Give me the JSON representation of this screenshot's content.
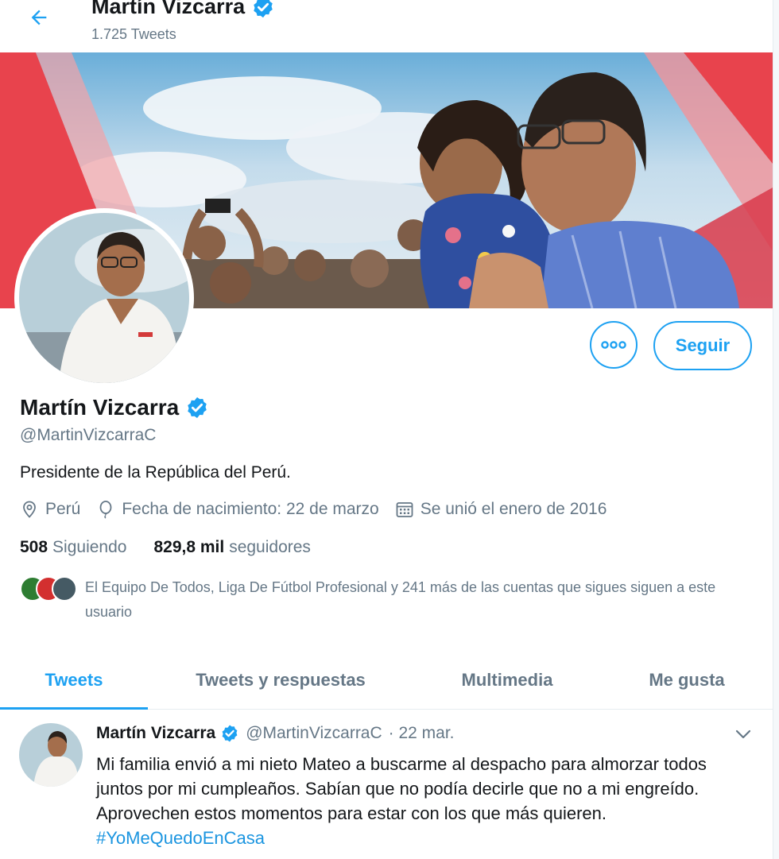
{
  "header": {
    "title": "Martín Vizcarra",
    "tweet_count": "1.725 Tweets"
  },
  "profile": {
    "name": "Martín Vizcarra",
    "handle": "@MartinVizcarraC",
    "bio": "Presidente de la República del Perú.",
    "location": "Perú",
    "birthday": "Fecha de nacimiento: 22 de marzo",
    "joined": "Se unió el enero de 2016",
    "following_count": "508",
    "following_label": "Siguiendo",
    "followers_count": "829,8 mil",
    "followers_label": "seguidores",
    "known_followers": "El Equipo De Todos, Liga De Fútbol Profesional y 241 más de las cuentas que sigues siguen a este usuario"
  },
  "actions": {
    "follow_label": "Seguir"
  },
  "tabs": [
    {
      "label": "Tweets"
    },
    {
      "label": "Tweets y respuestas"
    },
    {
      "label": "Multimedia"
    },
    {
      "label": "Me gusta"
    }
  ],
  "tweet": {
    "name": "Martín Vizcarra",
    "handle": "@MartinVizcarraC",
    "date": "· 22 mar.",
    "text": "Mi familia envió a mi nieto Mateo a buscarme al despacho para almorzar todos juntos por mi cumpleaños. Sabían que no podía decirle que no a mi engreído. Aprovechen estos momentos para estar con los que más quieren.",
    "hashtag": "#YoMeQuedoEnCasa"
  },
  "colors": {
    "accent": "#1da1f2",
    "text_primary": "#14171a",
    "text_secondary": "#657786",
    "banner_red": "#e8434d"
  },
  "icons": [
    "back-arrow-icon",
    "verified-badge-icon",
    "more-dots-icon",
    "location-pin-icon",
    "balloon-icon",
    "calendar-icon",
    "chevron-down-icon"
  ]
}
